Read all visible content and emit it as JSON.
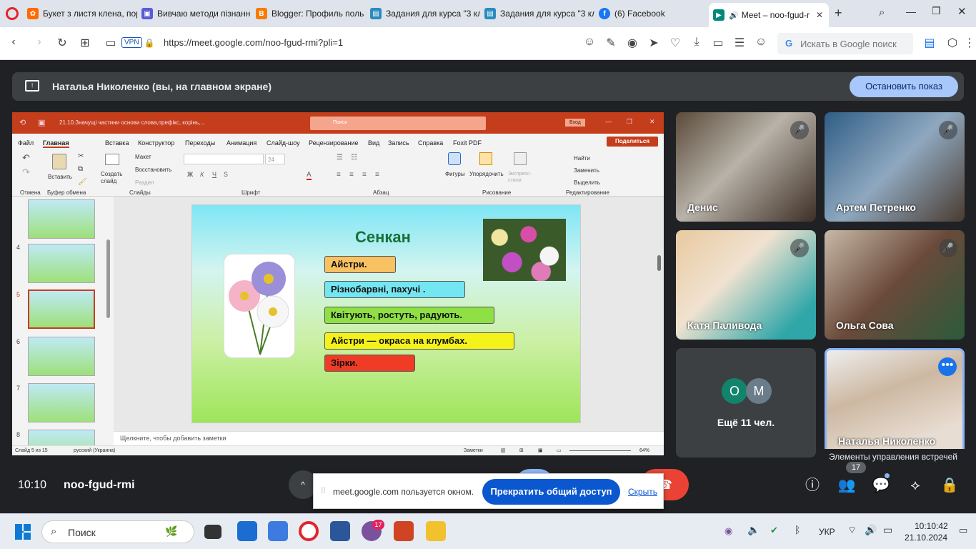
{
  "tabs": [
    {
      "title": "Букет з листя клена, пор",
      "color": "#ff6a00"
    },
    {
      "title": "Вивчаю методи пізнанн",
      "color": "#5b5bd6"
    },
    {
      "title": "Blogger: Профиль поль",
      "color": "#f57c00"
    },
    {
      "title": "Задания для курса \"3 кл",
      "color": "#2a8bbf"
    },
    {
      "title": "Задания для курса \"3 кл",
      "color": "#2a8bbf"
    },
    {
      "title": "(6) Facebook",
      "color": "#1877f2"
    },
    {
      "title": "Meet – noo-fgud-r",
      "color": "#00897b"
    }
  ],
  "browser": {
    "url": "https://meet.google.com/noo-fgud-rmi?pli=1",
    "vpn": "VPN",
    "search_placeholder": "Искать в Google поиск",
    "new_tab": "+"
  },
  "share": {
    "presenter": "Наталья Николенко (вы, на главном экране)",
    "stop_label": "Остановить показ"
  },
  "ppt": {
    "title": "21.10.Значущі частини основи слова,префікс, корінь,...",
    "search": "Поиск",
    "signin": "Вход",
    "share_btn": "Поделиться",
    "ribbon_tabs": [
      "Файл",
      "Главная",
      "Вставка",
      "Конструктор",
      "Переходы",
      "Анимация",
      "Слайд-шоу",
      "Рецензирование",
      "Вид",
      "Запись",
      "Справка",
      "Foxit PDF"
    ],
    "groups": [
      "Отмена",
      "Буфер обмена",
      "Слайды",
      "Шрифт",
      "Абзац",
      "Рисование",
      "Редактирование"
    ],
    "buttons": {
      "paste": "Вставить",
      "create": "Создать слайд",
      "layout": "Макет",
      "reset": "Восстановить",
      "section": "Раздел",
      "shapes": "Фигуры",
      "arrange": "Упорядочить",
      "express": "Экспресс-стили",
      "find": "Найти",
      "replace": "Заменить",
      "select": "Выделить"
    },
    "font_size": "24",
    "thumb_numbers": [
      "4",
      "5",
      "6",
      "7",
      "8"
    ],
    "notes": "Щелкните, чтобы добавить заметки",
    "status_slide": "Слайд 5 из 15",
    "status_lang": "русский (Украина)",
    "status_notes": "Заметки",
    "status_zoom": "64%"
  },
  "slide": {
    "title": "Сенкан",
    "answers": [
      {
        "text": "Айстри.",
        "color": "#f8c262"
      },
      {
        "text": "Різнобарвні, пахучі .",
        "color": "#74e6f2"
      },
      {
        "text": "Квітують, ростуть, радують.",
        "color": "#8ee044"
      },
      {
        "text": "Айстри — окраса на клумбах.",
        "color": "#f5f21a"
      },
      {
        "text": "Зірки.",
        "color": "#f03c24"
      }
    ]
  },
  "participants": [
    {
      "name": "Денис",
      "muted": true
    },
    {
      "name": "Артем Петренко",
      "muted": true
    },
    {
      "name": "Катя Паливода",
      "muted": true
    },
    {
      "name": "Ольга Сова",
      "muted": true
    }
  ],
  "others": {
    "avatars": [
      "О",
      "М"
    ],
    "label": "Ещё 11 чел.",
    "colors": [
      "#12846b",
      "#6b7c8a"
    ]
  },
  "self_tile": {
    "name": "Наталья Николенко",
    "tooltip": "Элементы управления встречей"
  },
  "meeting": {
    "time": "10:10",
    "code": "noo-fgud-rmi",
    "people_count": "17"
  },
  "sharing_notice": {
    "text": "meet.google.com пользуется окном.",
    "stop": "Прекратить общий доступ",
    "hide": "Скрыть"
  },
  "taskbar": {
    "search": "Поиск",
    "lang": "УКР",
    "time": "10:10:42",
    "date": "21.10.2024",
    "viber_badge": "17"
  }
}
